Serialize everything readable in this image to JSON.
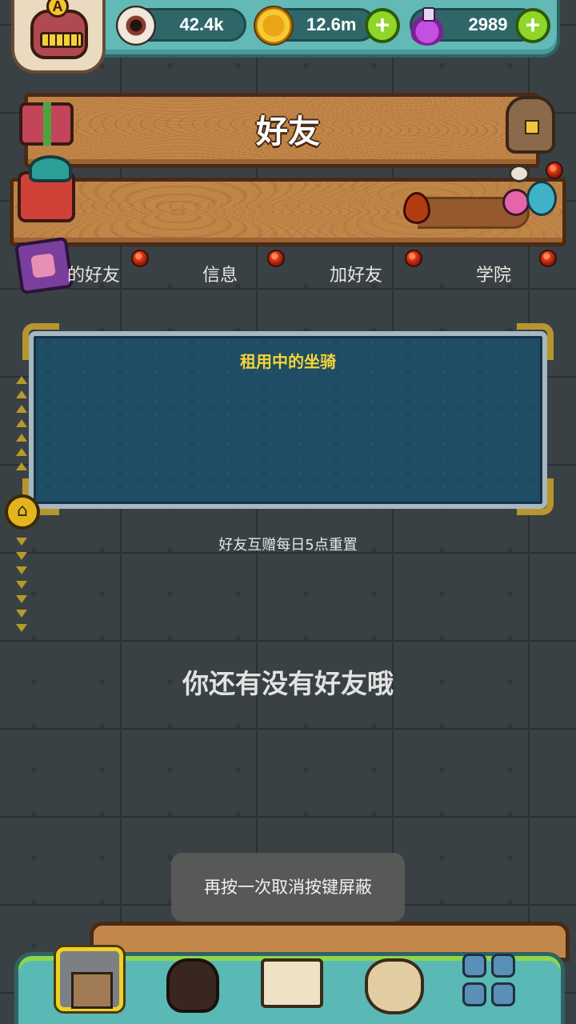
{
  "resources": {
    "eyes": "42.4k",
    "coins": "12.6m",
    "potions": "2989"
  },
  "avatar": {
    "rank_letter": "A"
  },
  "header": {
    "title": "好友"
  },
  "tabs": [
    {
      "label": "的好友"
    },
    {
      "label": "信息"
    },
    {
      "label": "加好友"
    },
    {
      "label": "学院"
    }
  ],
  "panel": {
    "title": "租用中的坐骑"
  },
  "reset_note": "好友互赠每日5点重置",
  "empty_message": "你还有没有好友哦",
  "toast": "再按一次取消按键屏蔽",
  "colors": {
    "panel_title": "#f6d434",
    "notification_dot": "#e43516",
    "accent_green": "#8fd52a"
  },
  "icons": {
    "eye": "eyeball-icon",
    "coin": "coin-icon",
    "potion": "potion-icon",
    "home": "home-icon"
  }
}
